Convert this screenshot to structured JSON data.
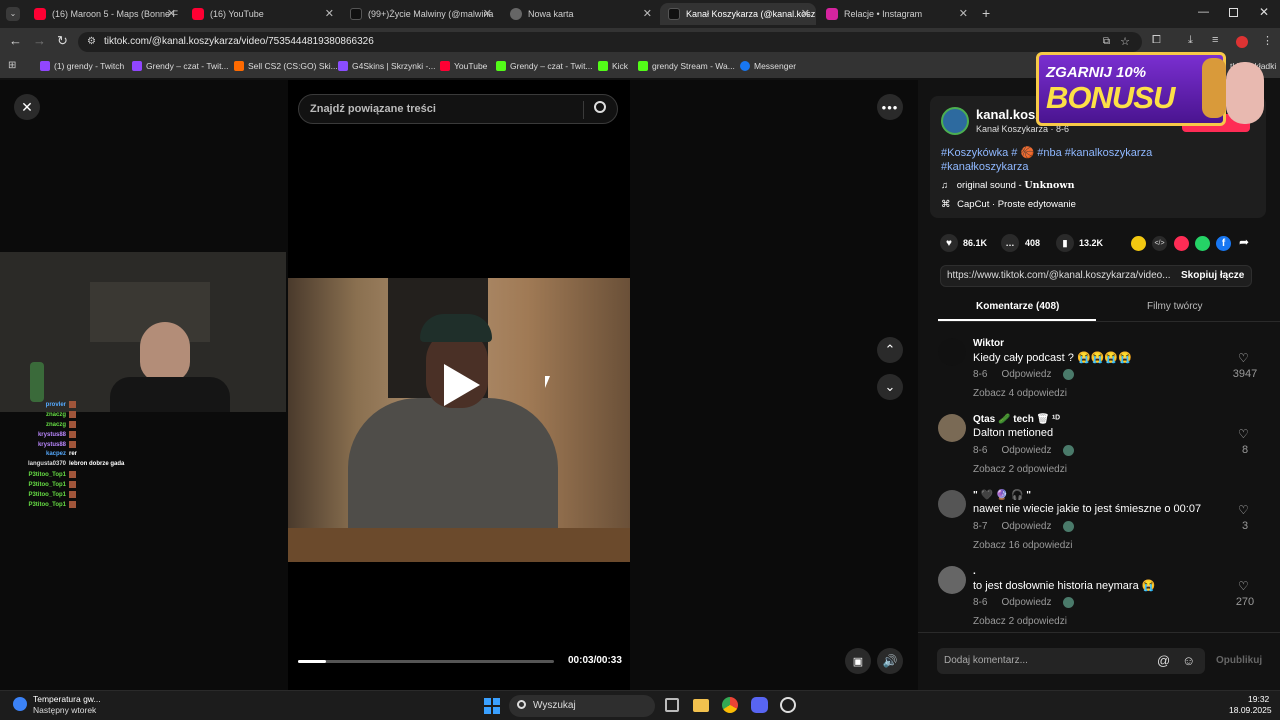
{
  "browser": {
    "tabs": [
      {
        "label": "(16) Maroon 5 - Maps (Bonne F",
        "color": "#ff0033"
      },
      {
        "label": "(16) YouTube",
        "color": "#ff0033"
      },
      {
        "label": "(99+)Życie Malwiny (@malwina",
        "color": "#111111"
      },
      {
        "label": "Nowa karta",
        "color": "#666666"
      },
      {
        "label": "Kanał Koszykarza (@kanal.kosz",
        "color": "#111111"
      },
      {
        "label": "Relacje • Instagram",
        "color": "#d6249f"
      }
    ],
    "url": "tiktok.com/@kanal.koszykarza/video/7535444819380866326",
    "bookmarks": [
      {
        "label": "(1) grendy - Twitch",
        "color": "#9146ff"
      },
      {
        "label": "Grendy – czat - Twit...",
        "color": "#9146ff"
      },
      {
        "label": "Sell CS2 (CS:GO) Ski...",
        "color": "#ff6a00"
      },
      {
        "label": "G4Skins | Skrzynki -...",
        "color": "#8a4dff"
      },
      {
        "label": "YouTube",
        "color": "#ff0033"
      },
      {
        "label": "Grendy – czat - Twit...",
        "color": "#53fc18"
      },
      {
        "label": "Kick",
        "color": "#53fc18"
      },
      {
        "label": "grendy Stream - Wa...",
        "color": "#53fc18"
      },
      {
        "label": "Messenger",
        "color": "#1877f2"
      }
    ],
    "bookmarks_end": "tkie zakładki"
  },
  "player": {
    "search_placeholder": "Znajdź powiązane treści",
    "time": "00:03/00:33",
    "progress": 0.11
  },
  "banner": {
    "line1": "ZGARNIJ 10%",
    "line2": "BONUSU"
  },
  "stream_chat": [
    {
      "user": "provler",
      "msg": "",
      "color": "#55aaff"
    },
    {
      "user": "znaczg",
      "msg": "",
      "color": "#66dd44"
    },
    {
      "user": "znaczg",
      "msg": "",
      "color": "#66dd44"
    },
    {
      "user": "krystus88",
      "msg": "",
      "color": "#bb88ff"
    },
    {
      "user": "krystus88",
      "msg": "",
      "color": "#bb88ff"
    },
    {
      "user": "kacpez",
      "msg": "rer",
      "color": "#55aaff"
    },
    {
      "user": "langusta0370",
      "msg": "lebron dobrze gada",
      "color": "#dddddd"
    },
    {
      "user": "P3titoo_Top1",
      "msg": "",
      "color": "#66dd44"
    },
    {
      "user": "P3titoo_Top1",
      "msg": "",
      "color": "#66dd44"
    },
    {
      "user": "P3titoo_Top1",
      "msg": "",
      "color": "#66dd44"
    },
    {
      "user": "P3titoo_Top1",
      "msg": "",
      "color": "#66dd44"
    }
  ],
  "creator": {
    "name": "kanal.kosz",
    "display_name": "Kanał Koszykarza",
    "date": "8-6",
    "hashtags_line1": "#Koszykówka # 🏀 #nba #kanalkoszykarza",
    "hashtags_line2": "#kanałkoszykarza",
    "sound_label": "original sound - ",
    "sound_artist": "Unknown",
    "capcut": "CapCut · Proste edytowanie"
  },
  "stats": {
    "likes": "86.1K",
    "comments": "408",
    "saves": "13.2K"
  },
  "link": {
    "url": "https://www.tiktok.com/@kanal.koszykarza/video...",
    "copy_label": "Skopiuj łącze"
  },
  "tabs": {
    "comments": "Komentarze (408)",
    "creator_videos": "Filmy twórcy"
  },
  "comments": [
    {
      "name": "Wiktor",
      "text": "Kiedy cały podcast ? 😭😭😭😭",
      "date": "8-6",
      "reply": "Odpowiedz",
      "more": "Zobacz 4 odpowiedzi",
      "likes": "3947",
      "avatar": "#111111"
    },
    {
      "name": "Qtas 🥒 tech 🗑 ¹ᴰ",
      "text": "Dalton metioned",
      "date": "8-6",
      "reply": "Odpowiedz",
      "more": "Zobacz 2 odpowiedzi",
      "likes": "8",
      "avatar": "#7a6a55"
    },
    {
      "name": "\" 🖤 🔮 🎧 \"",
      "text": "nawet nie wiecie jakie to jest śmieszne o 00:07",
      "date": "8-7",
      "reply": "Odpowiedz",
      "more": "Zobacz 16 odpowiedzi",
      "likes": "3",
      "avatar": "#555555"
    },
    {
      "name": ".",
      "text": "to jest dosłownie historia neymara 😭",
      "date": "8-6",
      "reply": "Odpowiedz",
      "more": "Zobacz 2 odpowiedzi",
      "likes": "270",
      "avatar": "#666666"
    }
  ],
  "comment_input": {
    "placeholder": "Dodaj komentarz...",
    "post": "Opublikuj"
  },
  "taskbar": {
    "weather_title": "Temperatura gw...",
    "weather_sub": "Następny wtorek",
    "search": "Wyszukaj",
    "time": "19:32",
    "date": "18.09.2025"
  }
}
